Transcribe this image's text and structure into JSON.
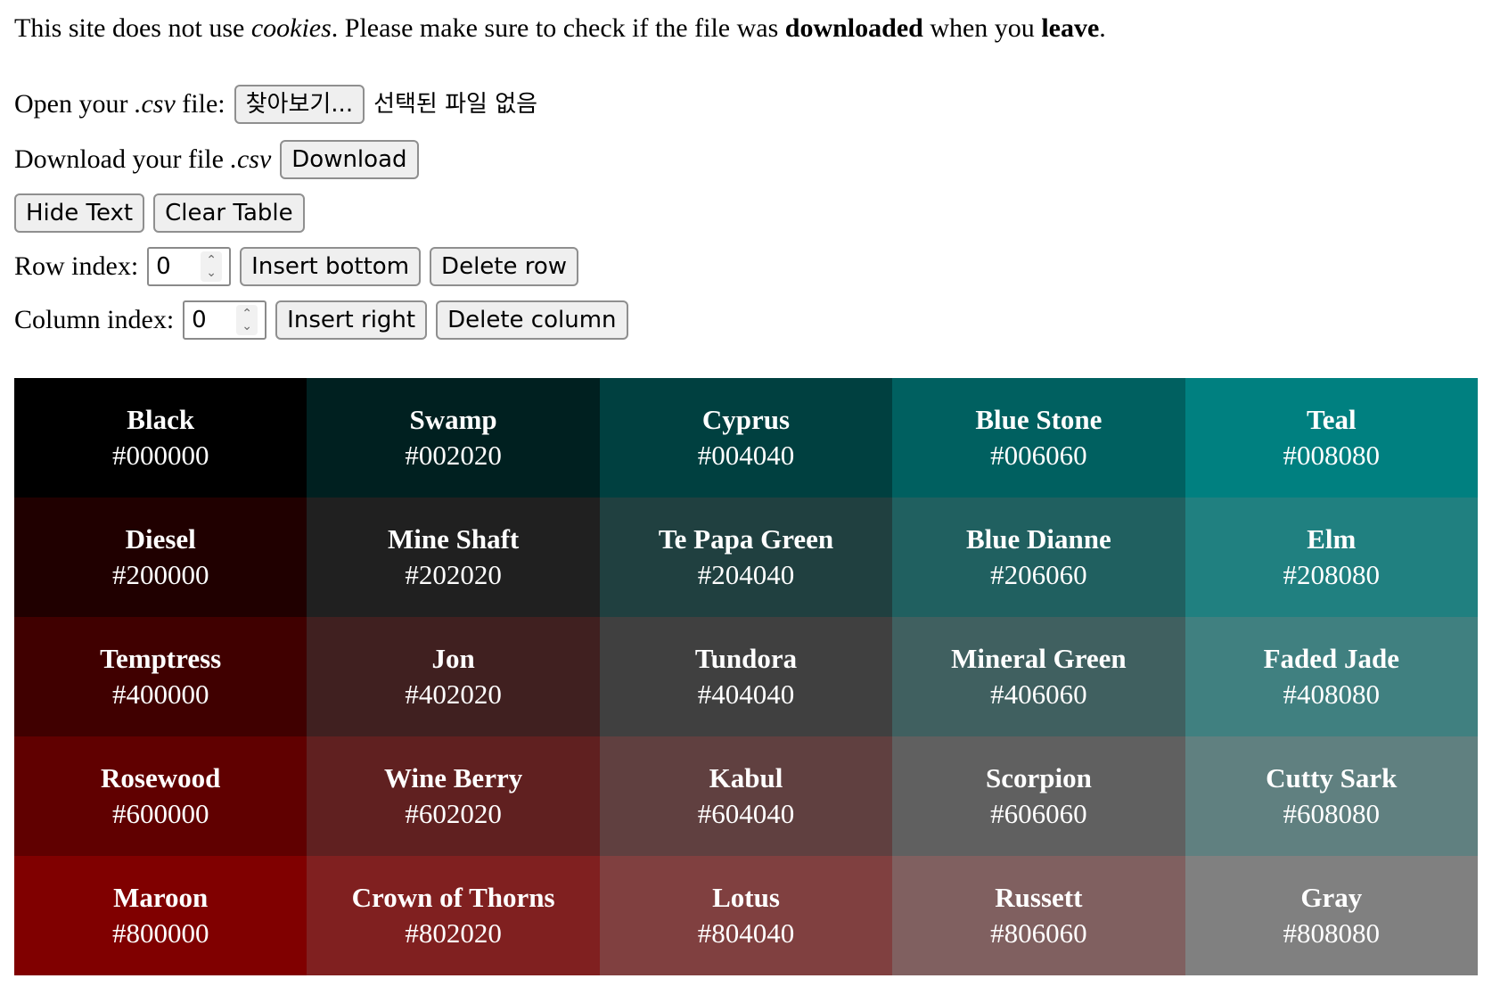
{
  "notice": {
    "part1": "This site does not use ",
    "cookies": "cookies",
    "part2": ". Please make sure to check if the file was ",
    "downloaded": "downloaded",
    "part3": " when you ",
    "leave": "leave",
    "part4": "."
  },
  "open_file": {
    "label_prefix": "Open your ",
    "label_ext": ".csv",
    "label_suffix": " file:",
    "browse_label": "찾아보기...",
    "status": "선택된 파일 없음"
  },
  "download": {
    "label_prefix": "Download your file ",
    "label_ext": ".csv",
    "button_label": "Download"
  },
  "toolbar": {
    "hide_text_label": "Hide Text",
    "clear_table_label": "Clear Table"
  },
  "row_controls": {
    "label": "Row index:",
    "value": "0",
    "insert_label": "Insert bottom",
    "delete_label": "Delete row"
  },
  "column_controls": {
    "label": "Column index:",
    "value": "0",
    "insert_label": "Insert right",
    "delete_label": "Delete column"
  },
  "table": {
    "rows": [
      [
        {
          "name": "Black",
          "hex": "#000000"
        },
        {
          "name": "Swamp",
          "hex": "#002020"
        },
        {
          "name": "Cyprus",
          "hex": "#004040"
        },
        {
          "name": "Blue Stone",
          "hex": "#006060"
        },
        {
          "name": "Teal",
          "hex": "#008080"
        }
      ],
      [
        {
          "name": "Diesel",
          "hex": "#200000"
        },
        {
          "name": "Mine Shaft",
          "hex": "#202020"
        },
        {
          "name": "Te Papa Green",
          "hex": "#204040"
        },
        {
          "name": "Blue Dianne",
          "hex": "#206060"
        },
        {
          "name": "Elm",
          "hex": "#208080"
        }
      ],
      [
        {
          "name": "Temptress",
          "hex": "#400000"
        },
        {
          "name": "Jon",
          "hex": "#402020"
        },
        {
          "name": "Tundora",
          "hex": "#404040"
        },
        {
          "name": "Mineral Green",
          "hex": "#406060"
        },
        {
          "name": "Faded Jade",
          "hex": "#408080"
        }
      ],
      [
        {
          "name": "Rosewood",
          "hex": "#600000"
        },
        {
          "name": "Wine Berry",
          "hex": "#602020"
        },
        {
          "name": "Kabul",
          "hex": "#604040"
        },
        {
          "name": "Scorpion",
          "hex": "#606060"
        },
        {
          "name": "Cutty Sark",
          "hex": "#608080"
        }
      ],
      [
        {
          "name": "Maroon",
          "hex": "#800000"
        },
        {
          "name": "Crown of Thorns",
          "hex": "#802020"
        },
        {
          "name": "Lotus",
          "hex": "#804040"
        },
        {
          "name": "Russett",
          "hex": "#806060"
        },
        {
          "name": "Gray",
          "hex": "#808080"
        }
      ]
    ]
  }
}
